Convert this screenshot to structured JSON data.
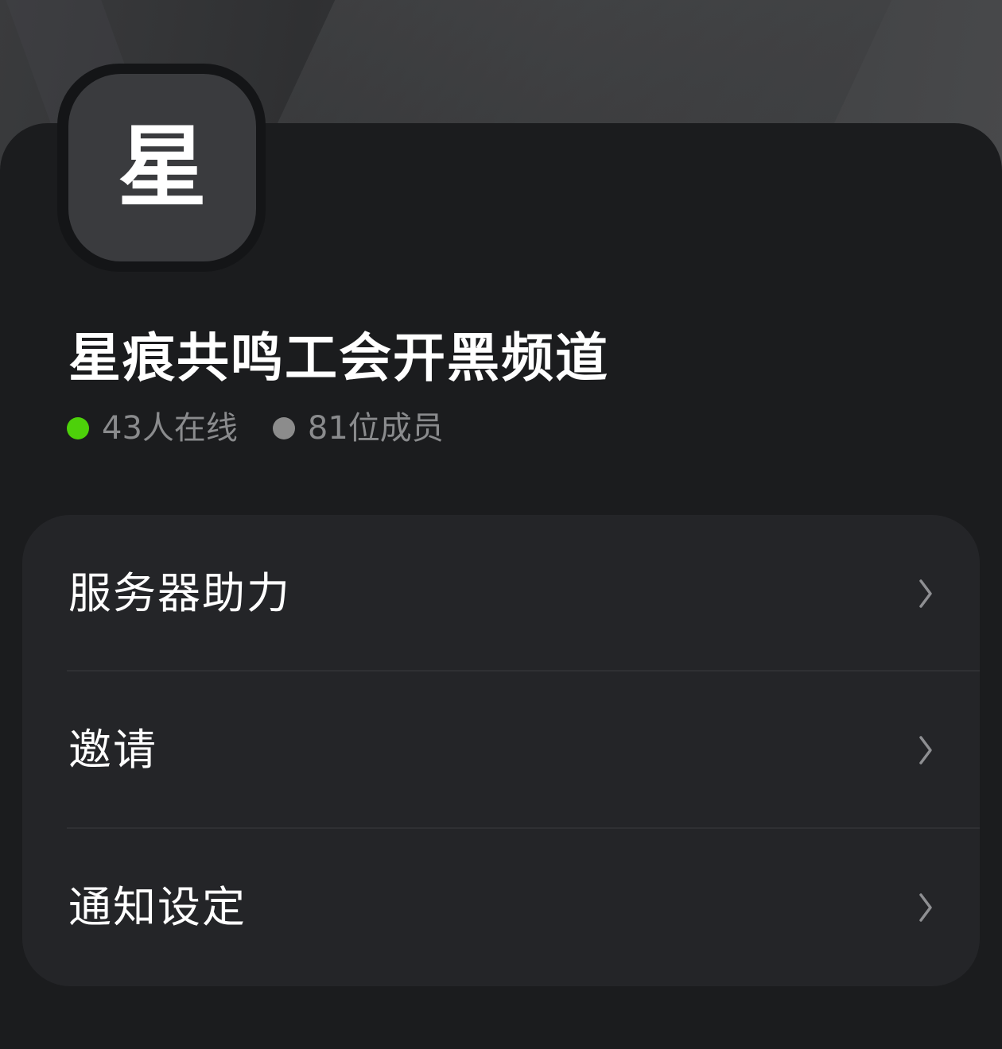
{
  "server": {
    "avatar_char": "星",
    "name": "星痕共鸣工会开黑频道",
    "online_text": "43人在线",
    "members_text": "81位成员"
  },
  "menu": {
    "items": [
      {
        "label": "服务器助力",
        "icon": "chevron-right-icon"
      },
      {
        "label": "邀请",
        "icon": "chevron-right-icon"
      },
      {
        "label": "通知设定",
        "icon": "chevron-right-icon"
      }
    ]
  },
  "colors": {
    "background": "#1b1c1e",
    "card": "#242528",
    "online_dot": "#4dd10a",
    "member_dot": "#8c8c8c",
    "secondary_text": "#8a8b8d"
  }
}
